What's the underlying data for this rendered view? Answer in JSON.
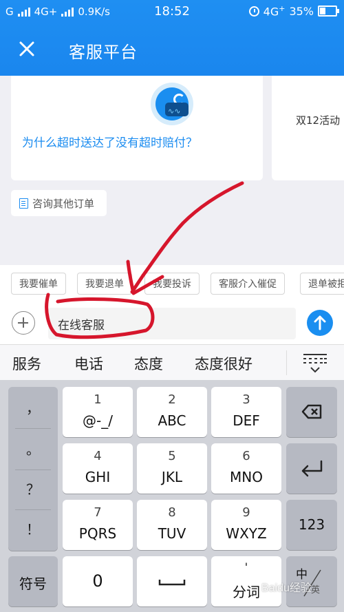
{
  "status_bar": {
    "left_signal_1": "G",
    "left_signal_2": "4G+",
    "net_speed": "0.9K/s",
    "time": "18:52",
    "right_signal": "4G",
    "right_signal_sup": "+",
    "battery": "35%"
  },
  "header": {
    "close_icon": "close-icon",
    "title": "客服平台"
  },
  "chat": {
    "question": "为什么超时送达了没有超时赔付？",
    "card2_text": "双12活动",
    "consult_label": "咨询其他订单"
  },
  "quick_tags": [
    "我要催单",
    "我要退单",
    "我要投诉",
    "客服介入催促",
    "退单被拒"
  ],
  "input": {
    "value": "在线客服"
  },
  "candidates": [
    "服务",
    "电话",
    "态度",
    "态度很好"
  ],
  "keyboard": {
    "punct": [
      "，",
      "。",
      "？",
      "！"
    ],
    "keys": [
      {
        "num": "1",
        "letters": "@-_/"
      },
      {
        "num": "2",
        "letters": "ABC"
      },
      {
        "num": "3",
        "letters": "DEF"
      },
      {
        "num": "4",
        "letters": "GHI"
      },
      {
        "num": "5",
        "letters": "JKL"
      },
      {
        "num": "6",
        "letters": "MNO"
      },
      {
        "num": "7",
        "letters": "PQRS"
      },
      {
        "num": "8",
        "letters": "TUV"
      },
      {
        "num": "9",
        "letters": "WXYZ"
      }
    ],
    "num_mode": "123",
    "symbols": "符号",
    "zero": "0",
    "space": "␣",
    "fenci_top": "'",
    "fenci": "分词",
    "lang": "中",
    "lang_sub": "英"
  },
  "watermark": "Baidu经验",
  "colors": {
    "brand_blue": "#1a8ef0",
    "link_blue": "#1b8cf0",
    "annotation_red": "#d6162c"
  }
}
